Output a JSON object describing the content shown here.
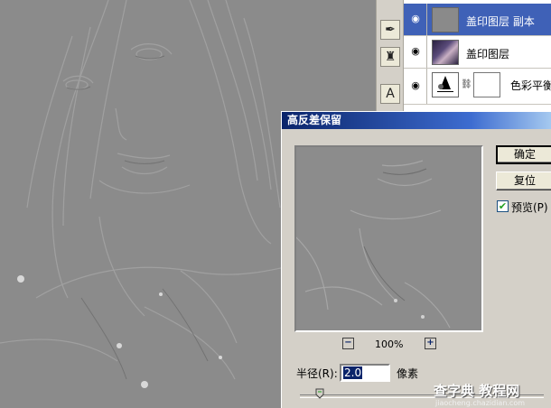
{
  "layers": [
    {
      "name": "盖印图层 副本",
      "selected": true
    },
    {
      "name": "盖印图层",
      "selected": false
    },
    {
      "name": "色彩平衡",
      "selected": false
    }
  ],
  "dialog": {
    "title": "高反差保留",
    "ok_label": "确定",
    "reset_label": "复位",
    "preview_label": "预览(P)",
    "preview_checked": true,
    "zoom_out": "−",
    "zoom_in": "+",
    "zoom_level": "100%",
    "radius_label": "半径(R):",
    "radius_value": "2.0",
    "radius_unit": "像素"
  },
  "watermark": {
    "text": "查字典 教程网",
    "url": "jiaocheng.chazidian.com"
  }
}
